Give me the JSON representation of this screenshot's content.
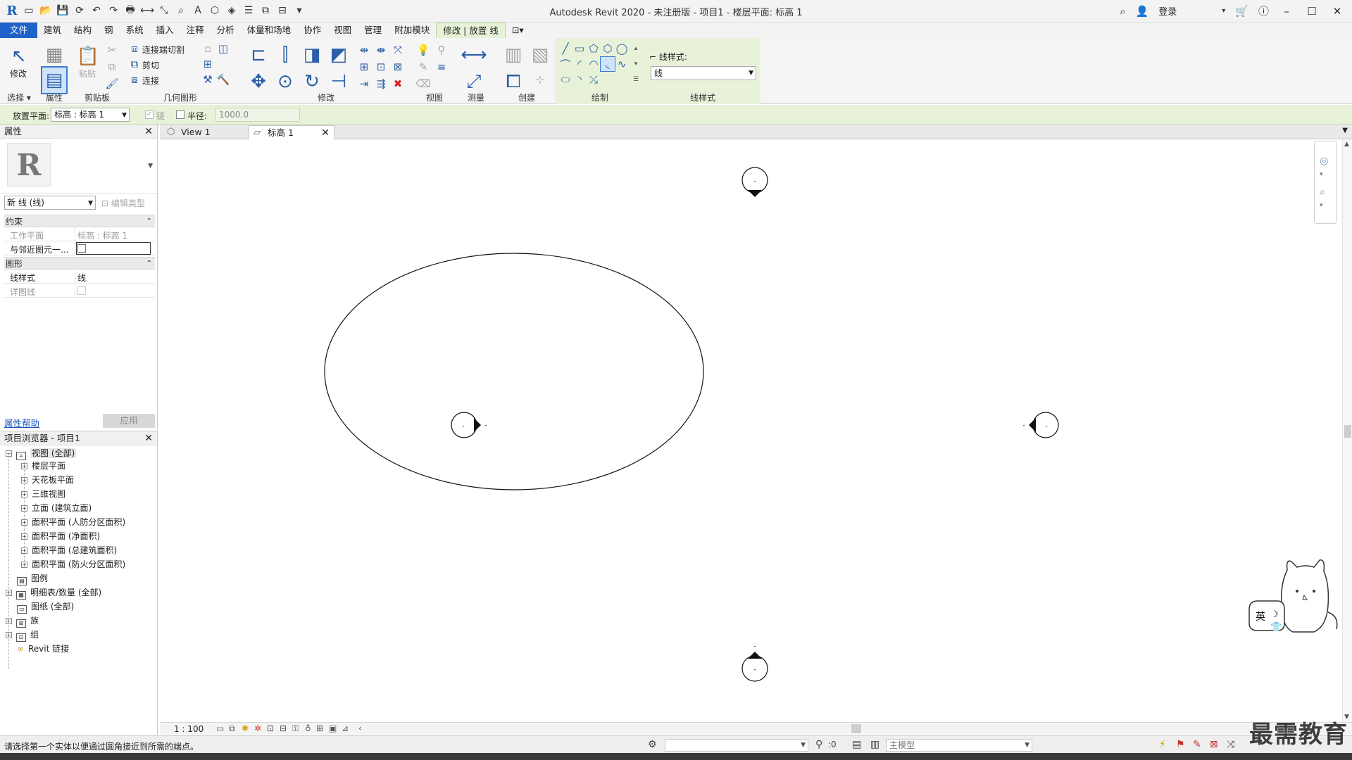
{
  "app": {
    "title": "Autodesk Revit 2020 - 未注册版 - 项目1 - 楼层平面: 标高 1",
    "logo_letter": "R",
    "login": "登录"
  },
  "tabs": [
    "文件",
    "建筑",
    "结构",
    "钢",
    "系统",
    "插入",
    "注释",
    "分析",
    "体量和场地",
    "协作",
    "视图",
    "管理",
    "附加模块",
    "修改 | 放置 线"
  ],
  "ribbon": {
    "panels": {
      "select": "选择",
      "properties": "属性",
      "clipboard": "剪贴板",
      "geometry": "几何图形",
      "modify": "修改",
      "view": "视图",
      "measure": "测量",
      "create": "创建",
      "draw": "绘制",
      "linestyle": "线样式"
    },
    "modify_label": "修改",
    "paste_label": "粘贴",
    "cope_label": "连接端切割",
    "cut_label": "剪切",
    "join_label": "连接",
    "linestyle_caption": "线样式:",
    "linestyle_value": "线"
  },
  "options": {
    "placement_label": "放置平面:",
    "placement_value": "标高 : 标高 1",
    "chain_label": "链",
    "radius_label": "半径:",
    "radius_value": "1000.0"
  },
  "properties": {
    "header": "属性",
    "type_name": "新 线 (线)",
    "edit_type": "编辑类型",
    "groups": {
      "constraints": "约束",
      "graphics": "图形"
    },
    "rows": {
      "workplane_key": "工作平面",
      "workplane_val": "标高 : 标高 1",
      "adjacent_key": "与邻近图元一...",
      "linestyle_key": "线样式",
      "linestyle_val": "线",
      "detail_key": "详图线"
    },
    "help": "属性帮助",
    "apply": "应用"
  },
  "browser": {
    "header": "项目浏览器 - 项目1",
    "items": [
      "视图 (全部)",
      "楼层平面",
      "天花板平面",
      "三维视图",
      "立面 (建筑立面)",
      "面积平面 (人防分区面积)",
      "面积平面 (净面积)",
      "面积平面 (总建筑面积)",
      "面积平面 (防火分区面积)",
      "图例",
      "明细表/数量 (全部)",
      "图纸 (全部)",
      "族",
      "组",
      "Revit 链接"
    ]
  },
  "view_tabs": [
    "View 1",
    "标高 1"
  ],
  "view_controls": {
    "scale": "1 : 100"
  },
  "status": {
    "message": "请选择第一个实体以便通过圆角接近到所需的端点。",
    "zero": ":0",
    "model": "主模型"
  },
  "mascot": {
    "ime": "英"
  },
  "watermark": "最需教育",
  "colors": {
    "accent": "#1f62c9",
    "context_tab": "#e5f2d6"
  }
}
